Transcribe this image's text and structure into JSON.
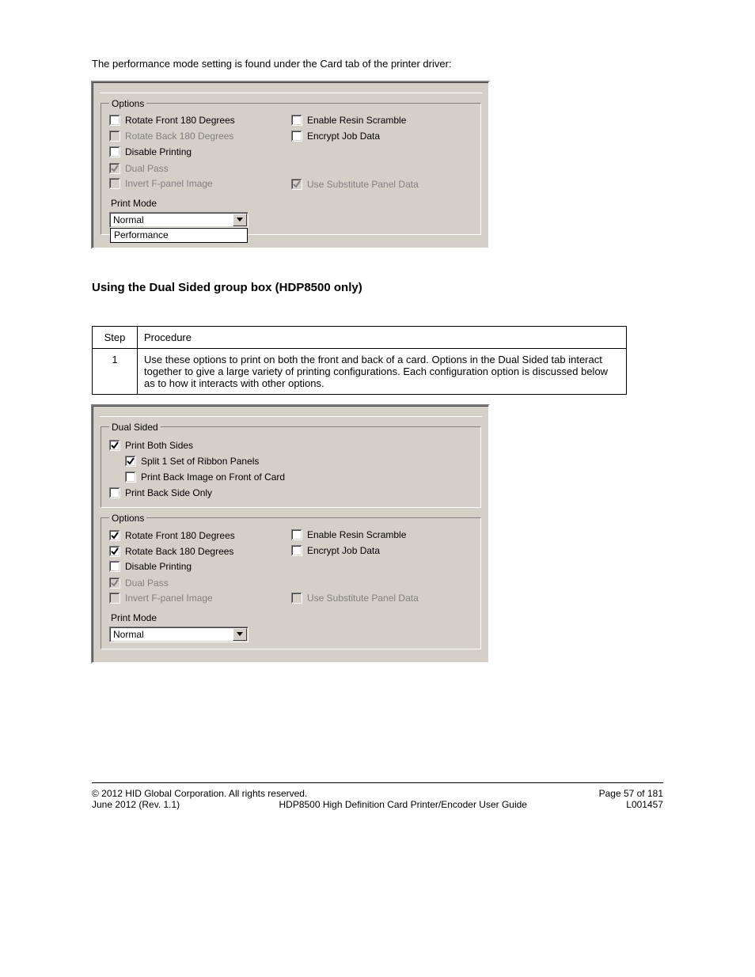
{
  "intro_text": "The performance mode setting is found under the Card tab of the printer driver:",
  "panel1": {
    "options_legend": "Options",
    "left": [
      {
        "label": "Rotate Front 180 Degrees",
        "checked": false,
        "disabled": false,
        "name": "rotate-front-checkbox"
      },
      {
        "label": "Rotate Back 180 Degrees",
        "checked": false,
        "disabled": true,
        "name": "rotate-back-checkbox"
      },
      {
        "label": "Disable Printing",
        "checked": false,
        "disabled": false,
        "name": "disable-printing-checkbox"
      },
      {
        "label": "Dual Pass",
        "checked": true,
        "disabled": true,
        "name": "dual-pass-checkbox"
      },
      {
        "label": "Invert F-panel Image",
        "checked": false,
        "disabled": true,
        "name": "invert-fpanel-checkbox"
      }
    ],
    "right": [
      {
        "label": "Enable Resin Scramble",
        "checked": false,
        "disabled": false,
        "name": "enable-resin-scramble-checkbox"
      },
      {
        "label": "Encrypt Job Data",
        "checked": false,
        "disabled": false,
        "name": "encrypt-job-data-checkbox"
      },
      {
        "label": "",
        "checked": false,
        "disabled": false,
        "name": "blank-row"
      },
      {
        "label": "",
        "checked": false,
        "disabled": false,
        "name": "blank-row2"
      },
      {
        "label": "Use Substitute Panel Data",
        "checked": true,
        "disabled": true,
        "name": "use-substitute-panel-checkbox"
      }
    ],
    "print_mode_label": "Print Mode",
    "print_mode_value": "Normal",
    "print_mode_options": [
      "Performance"
    ]
  },
  "step_heading": "Using the Dual Sided group box (HDP8500 only)",
  "step_table": {
    "step_header": "Step",
    "proc_header": "Procedure",
    "step_num": "1",
    "proc_text": "Use these options to print on both the front and back of a card. Options in the Dual Sided tab interact together to give a large variety of printing configurations. Each configuration option is discussed below as to how it interacts with other options."
  },
  "panel2": {
    "dual_legend": "Dual Sided",
    "dual_items": [
      {
        "label": "Print Both Sides",
        "checked": true,
        "disabled": false,
        "indent": 0,
        "name": "print-both-sides-checkbox"
      },
      {
        "label": "Split 1 Set of Ribbon Panels",
        "checked": true,
        "disabled": false,
        "indent": 1,
        "name": "split-ribbon-panels-checkbox"
      },
      {
        "label": "Print Back Image on Front of Card",
        "checked": false,
        "disabled": false,
        "indent": 1,
        "name": "print-back-on-front-checkbox"
      },
      {
        "label": "Print Back Side Only",
        "checked": false,
        "disabled": false,
        "indent": 0,
        "name": "print-back-only-checkbox"
      }
    ],
    "options_legend": "Options",
    "left": [
      {
        "label": "Rotate Front 180 Degrees",
        "checked": true,
        "disabled": false,
        "name": "rotate-front-checkbox-2"
      },
      {
        "label": "Rotate Back 180 Degrees",
        "checked": true,
        "disabled": false,
        "name": "rotate-back-checkbox-2"
      },
      {
        "label": "Disable Printing",
        "checked": false,
        "disabled": false,
        "name": "disable-printing-checkbox-2"
      },
      {
        "label": "Dual Pass",
        "checked": true,
        "disabled": true,
        "name": "dual-pass-checkbox-2"
      },
      {
        "label": "Invert F-panel Image",
        "checked": false,
        "disabled": true,
        "name": "invert-fpanel-checkbox-2"
      }
    ],
    "right": [
      {
        "label": "Enable Resin Scramble",
        "checked": false,
        "disabled": false,
        "name": "enable-resin-scramble-checkbox-2"
      },
      {
        "label": "Encrypt Job Data",
        "checked": false,
        "disabled": false,
        "name": "encrypt-job-data-checkbox-2"
      },
      {
        "label": "",
        "checked": false,
        "disabled": false,
        "name": "blank-row-b"
      },
      {
        "label": "",
        "checked": false,
        "disabled": false,
        "name": "blank-row2-b"
      },
      {
        "label": "Use Substitute Panel Data",
        "checked": false,
        "disabled": true,
        "name": "use-substitute-panel-checkbox-2"
      }
    ],
    "print_mode_label": "Print Mode",
    "print_mode_value": "Normal"
  },
  "footer": {
    "copyright": "© 2012 HID Global Corporation. All rights reserved.",
    "page_of": "Page 57 of 181",
    "left_code": "June 2012 (Rev. 1.1)",
    "doc_title": "HDP8500 High Definition Card Printer/Encoder User Guide",
    "right_code": "L001457"
  }
}
